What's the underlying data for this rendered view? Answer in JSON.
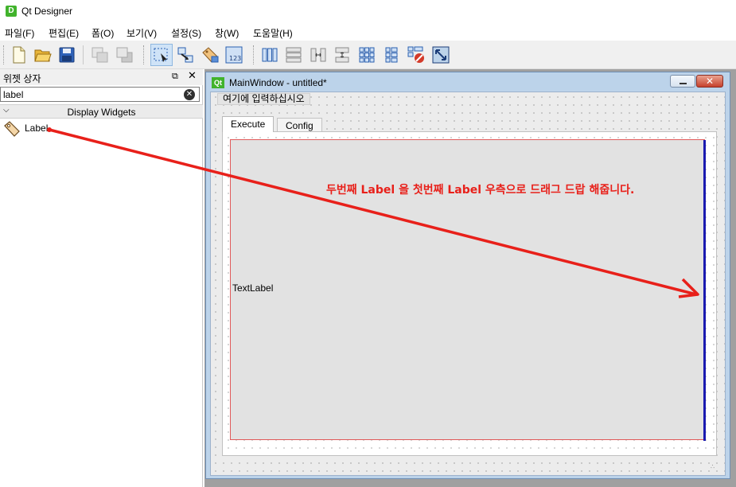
{
  "app": {
    "title": "Qt Designer",
    "icon_letter": "D"
  },
  "menubar": {
    "items": [
      "파일(F)",
      "편집(E)",
      "폼(O)",
      "보기(V)",
      "설정(S)",
      "창(W)",
      "도움말(H)"
    ]
  },
  "toolbar": {
    "buttons": [
      "new-file-icon",
      "open-file-icon",
      "save-icon",
      "send-to-back-icon",
      "bring-to-front-icon",
      "edit-widgets-icon",
      "edit-signals-slots-icon",
      "edit-buddies-icon",
      "edit-tab-order-icon",
      "layout-horizontal-icon",
      "layout-vertical-icon",
      "layout-horizontal-splitter-icon",
      "layout-vertical-splitter-icon",
      "layout-grid-icon",
      "layout-form-icon",
      "break-layout-icon",
      "adjust-size-icon"
    ],
    "active": "edit-widgets-icon"
  },
  "widget_box": {
    "title": "위젯 상자",
    "search_value": "label",
    "category": "Display Widgets",
    "items": [
      {
        "label": "Label",
        "icon": "label-tag-icon"
      }
    ]
  },
  "form_window": {
    "title": "MainWindow - untitled*",
    "icon_letter": "Qt",
    "menu_placeholder": "여기에 입력하십시오",
    "tabs": [
      "Execute",
      "Config"
    ],
    "active_tab": "Execute",
    "text_label": "TextLabel"
  },
  "annotation": {
    "text": "두번째 Label 을 첫번째 Label 우측으로 드래그 드랍 해줍니다.",
    "color": "#e8201a"
  },
  "colors": {
    "accent_green": "#41b32c",
    "drop_indicator": "#1a1ab0",
    "selection_border": "#e05a5a"
  }
}
